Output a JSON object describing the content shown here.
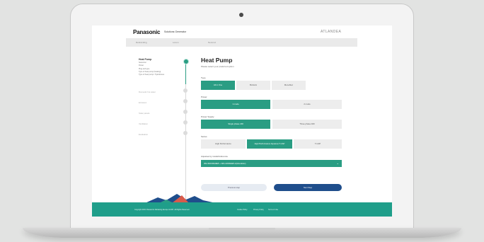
{
  "header": {
    "logo": "Panasonic",
    "app_name": "Solutions Generator",
    "brand_right": "ATLANDEA"
  },
  "nav": {
    "items": [
      "Rebranding",
      "Lorem",
      "Nonmoz"
    ]
  },
  "steps": {
    "active_title": "Heat Pump",
    "active_sub": [
      "Seleccion",
      "Power",
      "Plug and type",
      "Type of heat pump (heating)",
      "Type of heat pump / Hydroboxes"
    ],
    "rest": [
      "Domestic hot water",
      "Emission",
      "Solar panels",
      "Ventilation",
      "Evaluation"
    ]
  },
  "main": {
    "title": "Heat Pump",
    "subtitle": "Please select your preferred option",
    "type_label": "Type",
    "type_options": [
      "All in One",
      "Bi-block",
      "Monobloc"
    ],
    "power_label": "Power",
    "power_options": [
      "1 mode",
      "2 mode"
    ],
    "supply_label": "Power Supply",
    "supply_options": [
      "Single phase 230",
      "Three phase 400"
    ],
    "series_label": "Series",
    "series_options": [
      "High Performance",
      "High Performance Aquarea T-CAP",
      "T-CAP"
    ],
    "model_label": "Aquarea by model/reference",
    "model_value": "WH-SDC09H3E5 + WH-UD09HE5-1(Monobloc)",
    "back_label": "Previous step",
    "next_label": "Next Step"
  },
  "footer": {
    "left": "Copyright 2021 Panasonic Marketing Europe GmbH. All Rights Reserved.",
    "links": [
      "Cookie Policy",
      "Privacy Policy",
      "Terms of Use"
    ]
  },
  "colors": {
    "accent": "#2a9d83",
    "primary_button": "#1f4e8c",
    "footer": "#1f9e8a"
  }
}
